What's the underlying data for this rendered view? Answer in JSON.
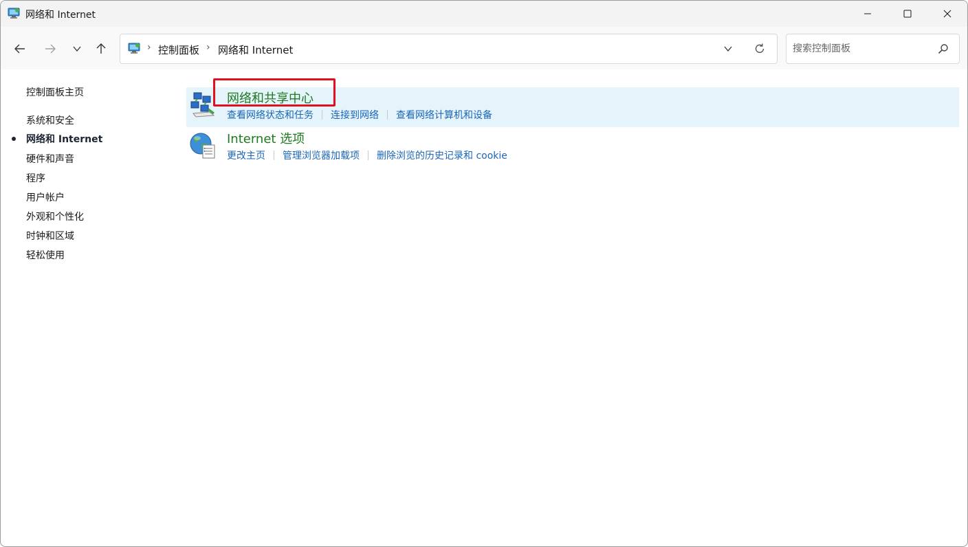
{
  "window": {
    "title": "网络和 Internet",
    "controls": {
      "minimize": "minimize-icon",
      "maximize": "maximize-icon",
      "close": "close-icon"
    }
  },
  "nav": {
    "back": "back-arrow-icon",
    "forward": "forward-arrow-icon",
    "recent": "chevron-down-icon",
    "up": "up-arrow-icon"
  },
  "address": {
    "crumbs": [
      "控制面板",
      "网络和 Internet"
    ],
    "separator": "›"
  },
  "search": {
    "placeholder": "搜索控制面板"
  },
  "sidebar": {
    "home": "控制面板主页",
    "items": [
      {
        "label": "系统和安全",
        "active": false
      },
      {
        "label": "网络和 Internet",
        "active": true
      },
      {
        "label": "硬件和声音",
        "active": false
      },
      {
        "label": "程序",
        "active": false
      },
      {
        "label": "用户帐户",
        "active": false
      },
      {
        "label": "外观和个性化",
        "active": false
      },
      {
        "label": "时钟和区域",
        "active": false
      },
      {
        "label": "轻松使用",
        "active": false
      }
    ]
  },
  "categories": [
    {
      "title": "网络和共享中心",
      "icon": "network-sharing-icon",
      "tasks": [
        "查看网络状态和任务",
        "连接到网络",
        "查看网络计算机和设备"
      ]
    },
    {
      "title": "Internet 选项",
      "icon": "internet-options-globe-icon",
      "tasks": [
        "更改主页",
        "管理浏览器加载项",
        "删除浏览的历史记录和 cookie"
      ]
    }
  ],
  "colors": {
    "title_green": "#1e7a1e",
    "link_blue": "#1a66b8",
    "hover_bg": "#e5f3fb",
    "highlight_red": "#e01020"
  }
}
